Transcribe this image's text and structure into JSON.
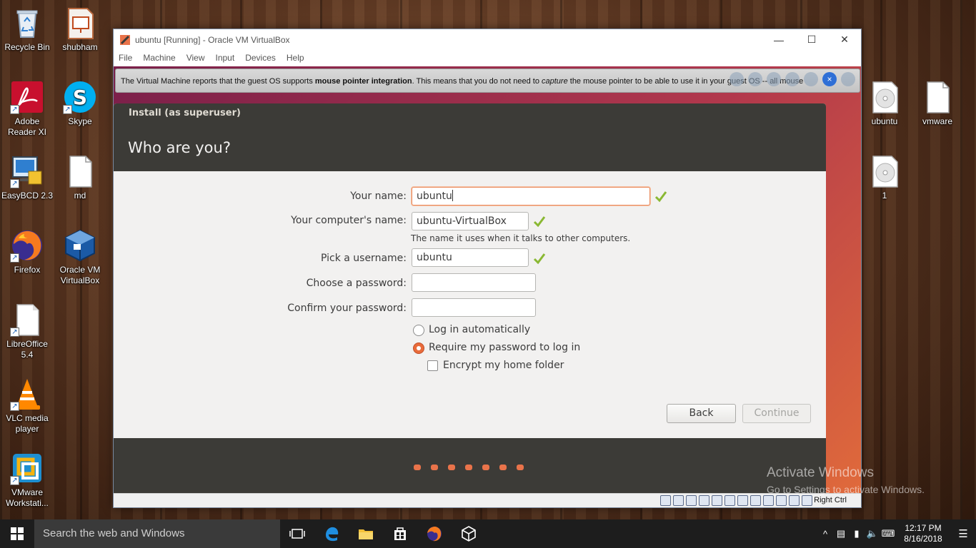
{
  "desktop": {
    "icons": [
      {
        "name": "recycle-bin",
        "label": "Recycle Bin",
        "icon": "recycle-bin-icon"
      },
      {
        "name": "shubham",
        "label": "shubham",
        "icon": "folder-presentation-icon"
      },
      {
        "name": "adobe-reader",
        "label": "Adobe Reader XI",
        "icon": "adobe-reader-icon"
      },
      {
        "name": "skype",
        "label": "Skype",
        "icon": "skype-icon"
      },
      {
        "name": "easybcd",
        "label": "EasyBCD 2.3",
        "icon": "easybcd-icon"
      },
      {
        "name": "md",
        "label": "md",
        "icon": "file-icon"
      },
      {
        "name": "firefox",
        "label": "Firefox",
        "icon": "firefox-icon"
      },
      {
        "name": "oracle-vm",
        "label": "Oracle VM VirtualBox",
        "icon": "virtualbox-icon"
      },
      {
        "name": "libreoffice",
        "label": "LibreOffice 5.4",
        "icon": "libreoffice-icon"
      },
      {
        "name": "vlc",
        "label": "VLC media player",
        "icon": "vlc-icon"
      },
      {
        "name": "vmware",
        "label": "VMware Workstati...",
        "icon": "vmware-icon"
      },
      {
        "name": "ubuntu-iso",
        "label": "ubuntu",
        "icon": "disc-image-icon"
      },
      {
        "name": "vmware-file",
        "label": "vmware",
        "icon": "file-icon"
      },
      {
        "name": "one-iso",
        "label": "1",
        "icon": "disc-image-icon"
      }
    ]
  },
  "vbox": {
    "title": "ubuntu [Running] - Oracle VM VirtualBox",
    "menu": [
      "File",
      "Machine",
      "View",
      "Input",
      "Devices",
      "Help"
    ],
    "notification": {
      "part1": "The Virtual Machine reports that the guest OS supports ",
      "bold": "mouse pointer integration",
      "part2": ". This means that you do not need to ",
      "italic": "capture",
      "part3": " the mouse pointer to be able to use it in your guest OS -- all mouse"
    },
    "host_key": "Right Ctrl"
  },
  "installer": {
    "small_title": "Install (as superuser)",
    "big_title": "Who are you?",
    "fields": {
      "your_name_label": "Your name:",
      "your_name_value": "ubuntu",
      "computer_name_label": "Your computer's name:",
      "computer_name_value": "ubuntu-VirtualBox",
      "computer_name_hint": "The name it uses when it talks to other computers.",
      "username_label": "Pick a username:",
      "username_value": "ubuntu",
      "password_label": "Choose a password:",
      "password_value": "",
      "confirm_label": "Confirm your password:",
      "confirm_value": ""
    },
    "options": {
      "login_auto": "Log in automatically",
      "require_password": "Require my password to log in",
      "encrypt_home": "Encrypt my home folder",
      "selected": "require_password",
      "encrypt_checked": false
    },
    "buttons": {
      "back": "Back",
      "continue": "Continue"
    },
    "progress_steps": 7
  },
  "watermark": {
    "line1": "Activate Windows",
    "line2": "Go to Settings to activate Windows."
  },
  "taskbar": {
    "search_placeholder": "Search the web and Windows",
    "time": "12:17 PM",
    "date": "8/16/2018"
  },
  "colors": {
    "ubuntu_orange": "#e9734a",
    "header_dark": "#3c3b37",
    "check_green": "#8ab833"
  }
}
